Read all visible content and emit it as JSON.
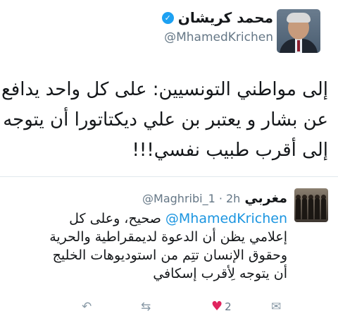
{
  "main_tweet": {
    "display_name": "محمد كريشان",
    "verified_mark": "✓",
    "handle": "@MhamedKrichen",
    "text_lines": [
      "إلى مواطني التونسيين: على كل واحد يدافع",
      "عن بشار و يعتبر بن علي ديكتاتورا أن يتوجه",
      "إلى أقرب طبيب نفسي!!!"
    ],
    "menu_icon": "chevron-down-icon"
  },
  "reply_tweet": {
    "display_name": "مغربي",
    "meta": "@Maghribi_1 · 2h",
    "mention": "@MhamedKrichen",
    "first_line_rest": " صحيح، وعلى كل",
    "text_lines": [
      "إعلامي يظن أن الدعوة لديمقراطية والحرية",
      "وحقوق الإنسان تتِم من استوديوهات الخليج",
      "أن يتوجه لِأقرب إسكافي"
    ],
    "menu_icon": "chevron-down-icon",
    "actions": {
      "reply_icon": "↶",
      "retweet_icon": "⇆",
      "like_icon": "♥",
      "like_count": "2",
      "dm_icon": "✉"
    }
  },
  "colors": {
    "link": "#1b95e0",
    "verified": "#1da1f2",
    "like": "#e0245e",
    "muted": "#657786"
  }
}
